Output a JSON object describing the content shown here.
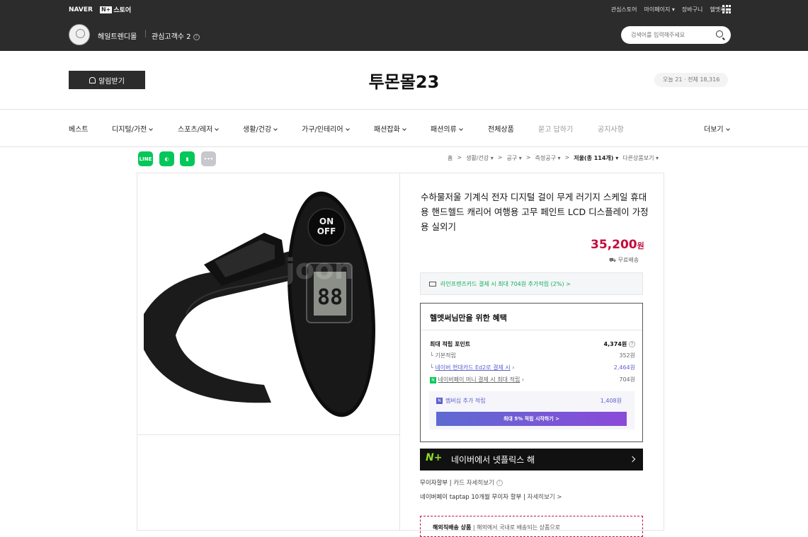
{
  "gnb": {
    "naver": "NAVER",
    "store_badge": "N+",
    "store_label": "스토어",
    "links": [
      "관심스토어",
      "마이페이지",
      "장바구니",
      "헬멧써"
    ]
  },
  "seller": {
    "name": "헤일트렌디몰",
    "interest": "관심고객수 2"
  },
  "search": {
    "placeholder": "검색어를 입력해주세요"
  },
  "shop": {
    "alarm": "알림받기",
    "title": "투몬몰23",
    "visits": "오늘 21 · 전체 18,316"
  },
  "categories": [
    "베스트",
    "디지털/가전",
    "스포츠/레저",
    "생활/건강",
    "가구/인테리어",
    "패션잡화",
    "패션의류",
    "전체상품",
    "묻고 답하기",
    "공지사항",
    "더보기"
  ],
  "breadcrumb": [
    "홈",
    "생활/건강",
    "공구",
    "측정공구",
    "저울(총 114개)",
    "다른상품보기"
  ],
  "product": {
    "name": "수하물저울 기계식 전자 디지털 걸이 무게 러기지 스케일 휴대용 핸드헬드 캐리어 여행용 고무 페인트 LCD 디스플레이 가정용 실외기",
    "price": "35,200",
    "currency": "원",
    "shipping": "무료배송",
    "display_on": "ON",
    "display_off": "OFF",
    "watermark": "joon"
  },
  "card_benefit": "라인프렌즈카드 결제 시 최대 704원 추가적립 (2%) >",
  "benefit": {
    "title": "헬멧써님만을 위한 혜택",
    "max_label": "최대 적립 포인트",
    "max_value": "4,374원",
    "rows": [
      {
        "label": "기본적립",
        "value": "352원"
      },
      {
        "label": "네이버 현대카드 Ed2로 결제 시",
        "value": "2,464원"
      },
      {
        "label": "네이버페이 머니 결제 시 최대 적립",
        "value": "704원"
      }
    ],
    "membership_label": "멤버십 추가 적립",
    "membership_value": "1,408원",
    "membership_button": "최대 5% 적립 시작하기 >"
  },
  "netflix": {
    "logo": "N+",
    "text": "네이버에서 넷플릭스 해"
  },
  "installment": {
    "line1": "무이자할부",
    "line1_detail": "카드 자세히보기",
    "line2": "네이버페이 taptap 10개월 무이자 할부",
    "line2_detail": "자세히보기 >"
  },
  "direct": {
    "label": "해외직배송 상품",
    "text": "해외에서 국내로 배송되는 상품으로"
  },
  "colors": {
    "header": "#2c2c2c",
    "price": "#c40d3b",
    "naver_green": "#03c75a",
    "membership": "#5b5ecd"
  }
}
